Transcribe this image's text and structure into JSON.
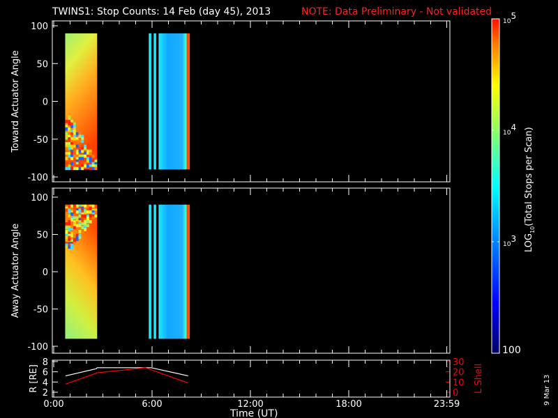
{
  "title": {
    "main": "TWINS1: Stop Counts: 14 Feb (day  45), 2013",
    "note": "NOTE: Data Preliminary - Not validated",
    "note_color": "#ff2020"
  },
  "date_stamp": "9 Mar 13",
  "chart_data": [
    {
      "type": "heatmap",
      "name": "toward",
      "ylabel": "Toward Actuator Angle",
      "ylim": [
        -100,
        100
      ],
      "yticks": [
        "100",
        "50",
        "0",
        "-50",
        "-100"
      ],
      "data_blocks_hours": [
        [
          0.7,
          2.65
        ],
        [
          5.8,
          5.95
        ],
        [
          6.1,
          6.25
        ],
        [
          6.4,
          8.3
        ]
      ]
    },
    {
      "type": "heatmap",
      "name": "away",
      "ylabel": "Away Actuator Angle",
      "ylim": [
        -100,
        100
      ],
      "yticks": [
        "100",
        "50",
        "0",
        "-50",
        "-100"
      ],
      "data_blocks_hours": [
        [
          0.7,
          2.65
        ],
        [
          5.8,
          5.95
        ],
        [
          6.1,
          6.25
        ],
        [
          6.4,
          8.3
        ]
      ]
    },
    {
      "type": "line",
      "name": "orbit",
      "ylabel": "R [RE]",
      "ylim": [
        2,
        8
      ],
      "yticks": [
        "8",
        "6",
        "4",
        "2"
      ],
      "y2label": "L Shell",
      "y2lim": [
        0,
        30
      ],
      "y2ticks": [
        "30",
        "20",
        "10",
        "0"
      ],
      "series": [
        {
          "name": "R",
          "color": "#ffffff",
          "x": [
            0.72,
            2.6,
            2.65,
            5.95,
            8.2
          ],
          "y": [
            5.2,
            6.6,
            6.8,
            6.8,
            5.2
          ]
        },
        {
          "name": "L Shell",
          "color": "#ff0000",
          "x": [
            0.72,
            2.65,
            5.6,
            8.2
          ],
          "y": [
            8,
            19,
            24,
            9
          ]
        }
      ]
    }
  ],
  "xaxis": {
    "label": "Time (UT)",
    "ticks": [
      {
        "h": 0,
        "label": "0:00"
      },
      {
        "h": 6,
        "label": "6:00"
      },
      {
        "h": 12,
        "label": "12:00"
      },
      {
        "h": 18,
        "label": "18:00"
      },
      {
        "h": 23.98,
        "label": "23:59"
      }
    ]
  },
  "colorbar": {
    "label": "LOG10(Total Stops per Scan)",
    "label_main": "LOG",
    "label_sub": "10",
    "label_rest": "(Total Stops per Scan)",
    "ticks": [
      {
        "exp": "5",
        "base": "10"
      },
      {
        "exp": "4",
        "base": "10"
      },
      {
        "exp": "3",
        "base": "10"
      }
    ],
    "min_label": "100",
    "range_log": [
      2,
      5
    ]
  }
}
